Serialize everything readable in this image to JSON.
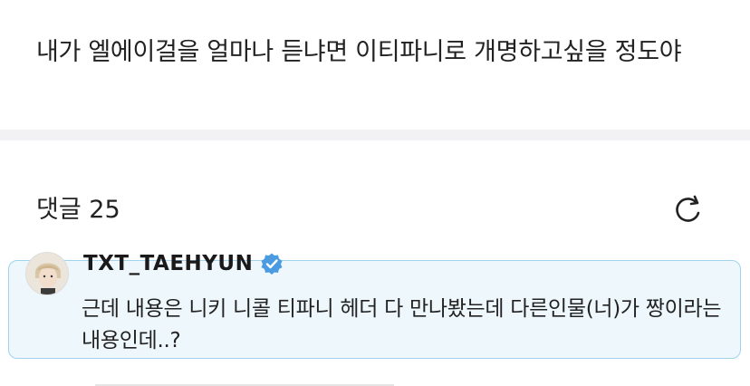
{
  "post": {
    "text": "내가 엘에이걸을 얼마나 듣냐면 이티파니로 개명하고싶을 정도야"
  },
  "comments": {
    "title": "댓글 25",
    "refresh_icon": "refresh-icon"
  },
  "comment": {
    "username": "TXT_TAEHYUN",
    "verified_icon": "verified-badge-icon",
    "text": "근데 내용은 니키 니콜 티파니 헤더 다 만나봤는데 다른인물(너)가 짱이라는 내용인데..?",
    "highlight_color": "#eef7fc",
    "border_color": "#9fd3ee",
    "badge_color": "#4a9be0"
  }
}
